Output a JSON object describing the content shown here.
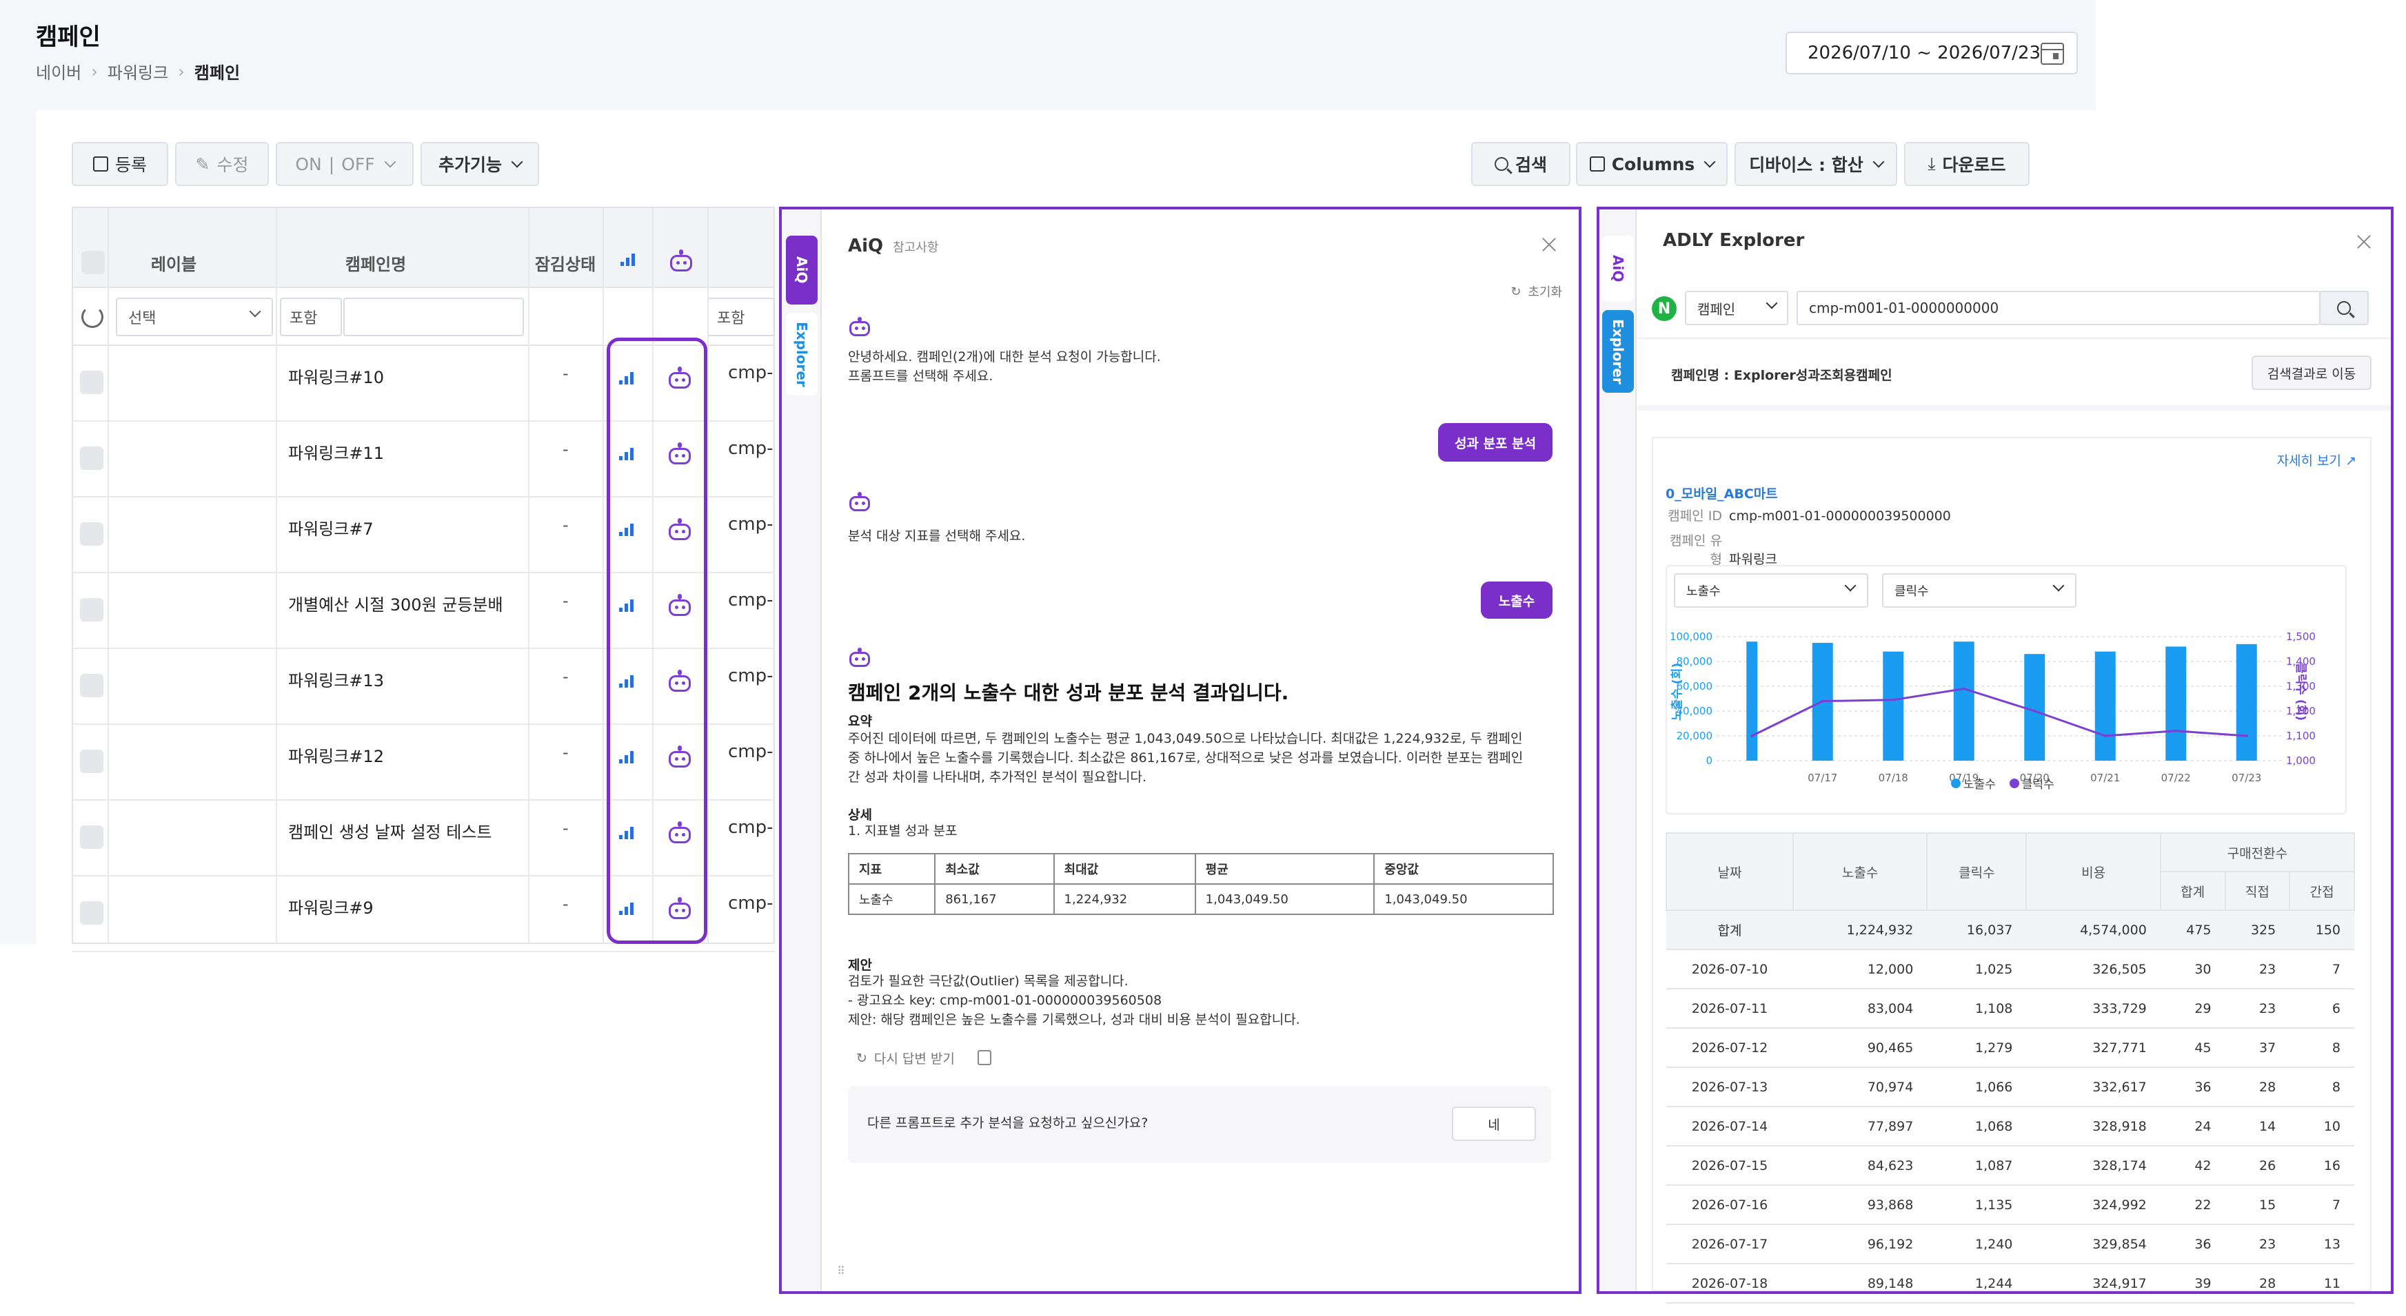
{
  "page": {
    "title": "캠페인",
    "breadcrumb": [
      "네이버",
      "파워링크",
      "캠페인"
    ],
    "date_range": "2026/07/10 ~ 2026/07/23"
  },
  "toolbar": {
    "register": "등록",
    "edit": "수정",
    "on": "ON",
    "off": "OFF",
    "extra": "추가기능",
    "search": "검색",
    "columns": "Columns",
    "device": "디바이스 : 합산",
    "download": "다운로드"
  },
  "table": {
    "headers": {
      "label": "레이블",
      "name": "캠페인명",
      "lock": "잠김상태"
    },
    "filter": {
      "select": "선택",
      "contains": "포함",
      "contains2": "포함"
    },
    "rows": [
      {
        "name": "파워링크#10",
        "state": "-",
        "id": "cmp-a"
      },
      {
        "name": "파워링크#11",
        "state": "-",
        "id": "cmp-a"
      },
      {
        "name": "파워링크#7",
        "state": "-",
        "id": "cmp-a"
      },
      {
        "name": "개별예산 시절 300원 균등분배",
        "state": "-",
        "id": "cmp-a"
      },
      {
        "name": "파워링크#13",
        "state": "-",
        "id": "cmp-a"
      },
      {
        "name": "파워링크#12",
        "state": "-",
        "id": "cmp-a"
      },
      {
        "name": "캠페인 생성 날짜 설정 테스트",
        "state": "-",
        "id": "cmp-a"
      },
      {
        "name": "파워링크#9",
        "state": "-",
        "id": "cmp-a"
      }
    ]
  },
  "aiq": {
    "title": "AiQ",
    "subtitle": "참고사항",
    "tab_aiq": "AiQ",
    "tab_explorer": "Explorer",
    "reset": "초기화",
    "greet_1": "안녕하세요. 캠페인(2개)에 대한 분석 요청이 가능합니다.",
    "greet_2": "프롬프트를 선택해 주세요.",
    "user_1": "성과 분포 분석",
    "bot_2": "분석 대상 지표를 선택해 주세요.",
    "user_2": "노출수",
    "result_title": "캠페인 2개의 노출수 대한 성과 분포 분석 결과입니다.",
    "summary_label": "요약",
    "summary_text": "주어진 데이터에 따르면, 두 캠페인의 노출수는 평균 1,043,049.50으로 나타났습니다. 최대값은 1,224,932로, 두 캠페인 중 하나에서 높은 노출수를 기록했습니다. 최소값은 861,167로, 상대적으로 낮은 성과를 보였습니다. 이러한 분포는 캠페인 간 성과 차이를 나타내며, 추가적인 분석이 필요합니다.",
    "detail_label": "상세",
    "detail_sub": "1. 지표별 성과 분포",
    "table_headers": [
      "지표",
      "최소값",
      "최대값",
      "평균",
      "중앙값"
    ],
    "table_row": [
      "노출수",
      "861,167",
      "1,224,932",
      "1,043,049.50",
      "1,043,049.50"
    ],
    "suggest_label": "제안",
    "suggest_1": "검토가 필요한 극단값(Outlier) 목록을 제공합니다.",
    "suggest_2": "- 광고요소 key: cmp-m001-01-000000039560508",
    "suggest_3": "제안: 해당 캠페인은 높은 노출수를 기록했으나, 성과 대비 비용 분석이 필요합니다.",
    "regen": "다시 답변 받기",
    "prompt_q": "다른 프롬프트로 추가 분석을 요청하고 싶으신가요?",
    "yes": "네"
  },
  "adly": {
    "title": "ADLY Explorer",
    "tab_aiq": "AiQ",
    "tab_explorer": "Explorer",
    "n": "N",
    "scope": "캠페인",
    "query": "cmp-m001-01-0000000000",
    "campaign_name": "캠페인명 : Explorer성과조회용캠페인",
    "goto": "검색결과로 이동",
    "more": "자세히 보기",
    "entity": "0_모바일_ABC마트",
    "id_label": "캠페인 ID",
    "id_value": "cmp-m001-01-000000039500000",
    "type_label": "캠페인 유형",
    "type_value": "파워링크",
    "metric1": "노출수",
    "metric2": "클릭수",
    "left_axis": "노출수 (회)",
    "right_axis": "클릭수 (회)",
    "legend": [
      "노출수",
      "클릭수"
    ],
    "table": {
      "h_date": "날짜",
      "h_imp": "노출수",
      "h_clk": "클릭수",
      "h_cost": "비용",
      "h_conv": "구매전환수",
      "h_total": "합계",
      "h_direct": "직접",
      "h_indirect": "간접",
      "rows": [
        [
          "합계",
          "1,224,932",
          "16,037",
          "4,574,000",
          "475",
          "325",
          "150"
        ],
        [
          "2026-07-10",
          "12,000",
          "1,025",
          "326,505",
          "30",
          "23",
          "7"
        ],
        [
          "2026-07-11",
          "83,004",
          "1,108",
          "333,729",
          "29",
          "23",
          "6"
        ],
        [
          "2026-07-12",
          "90,465",
          "1,279",
          "327,771",
          "45",
          "37",
          "8"
        ],
        [
          "2026-07-13",
          "70,974",
          "1,066",
          "332,617",
          "36",
          "28",
          "8"
        ],
        [
          "2026-07-14",
          "77,897",
          "1,068",
          "328,918",
          "24",
          "14",
          "10"
        ],
        [
          "2026-07-15",
          "84,623",
          "1,087",
          "328,174",
          "42",
          "26",
          "16"
        ],
        [
          "2026-07-16",
          "93,868",
          "1,135",
          "324,992",
          "22",
          "15",
          "7"
        ],
        [
          "2026-07-17",
          "96,192",
          "1,240",
          "329,854",
          "36",
          "23",
          "13"
        ],
        [
          "2026-07-18",
          "89,148",
          "1,244",
          "324,917",
          "39",
          "28",
          "11"
        ]
      ]
    }
  },
  "chart_data": {
    "type": "bar",
    "categories": [
      "07/17",
      "07/18",
      "07/19",
      "07/20",
      "07/21",
      "07/22",
      "07/23"
    ],
    "left_ticks": [
      "100,000",
      "80,000",
      "60,000",
      "40,000",
      "20,000",
      "0"
    ],
    "right_ticks": [
      "1,500",
      "1,400",
      "1,300",
      "1,200",
      "1,100",
      "1,000"
    ],
    "ylim": [
      0,
      100000
    ],
    "y2lim": [
      1000,
      1500
    ],
    "series": [
      {
        "name": "노출수",
        "type": "bar",
        "color": "#1a9df0",
        "values": [
          96000,
          95000,
          88000,
          96000,
          86000,
          88000,
          92000,
          94000
        ]
      },
      {
        "name": "클릭수",
        "type": "line",
        "color": "#7b3fd4",
        "values": [
          1100,
          1240,
          1245,
          1290,
          1200,
          1100,
          1120,
          1100
        ]
      }
    ]
  }
}
